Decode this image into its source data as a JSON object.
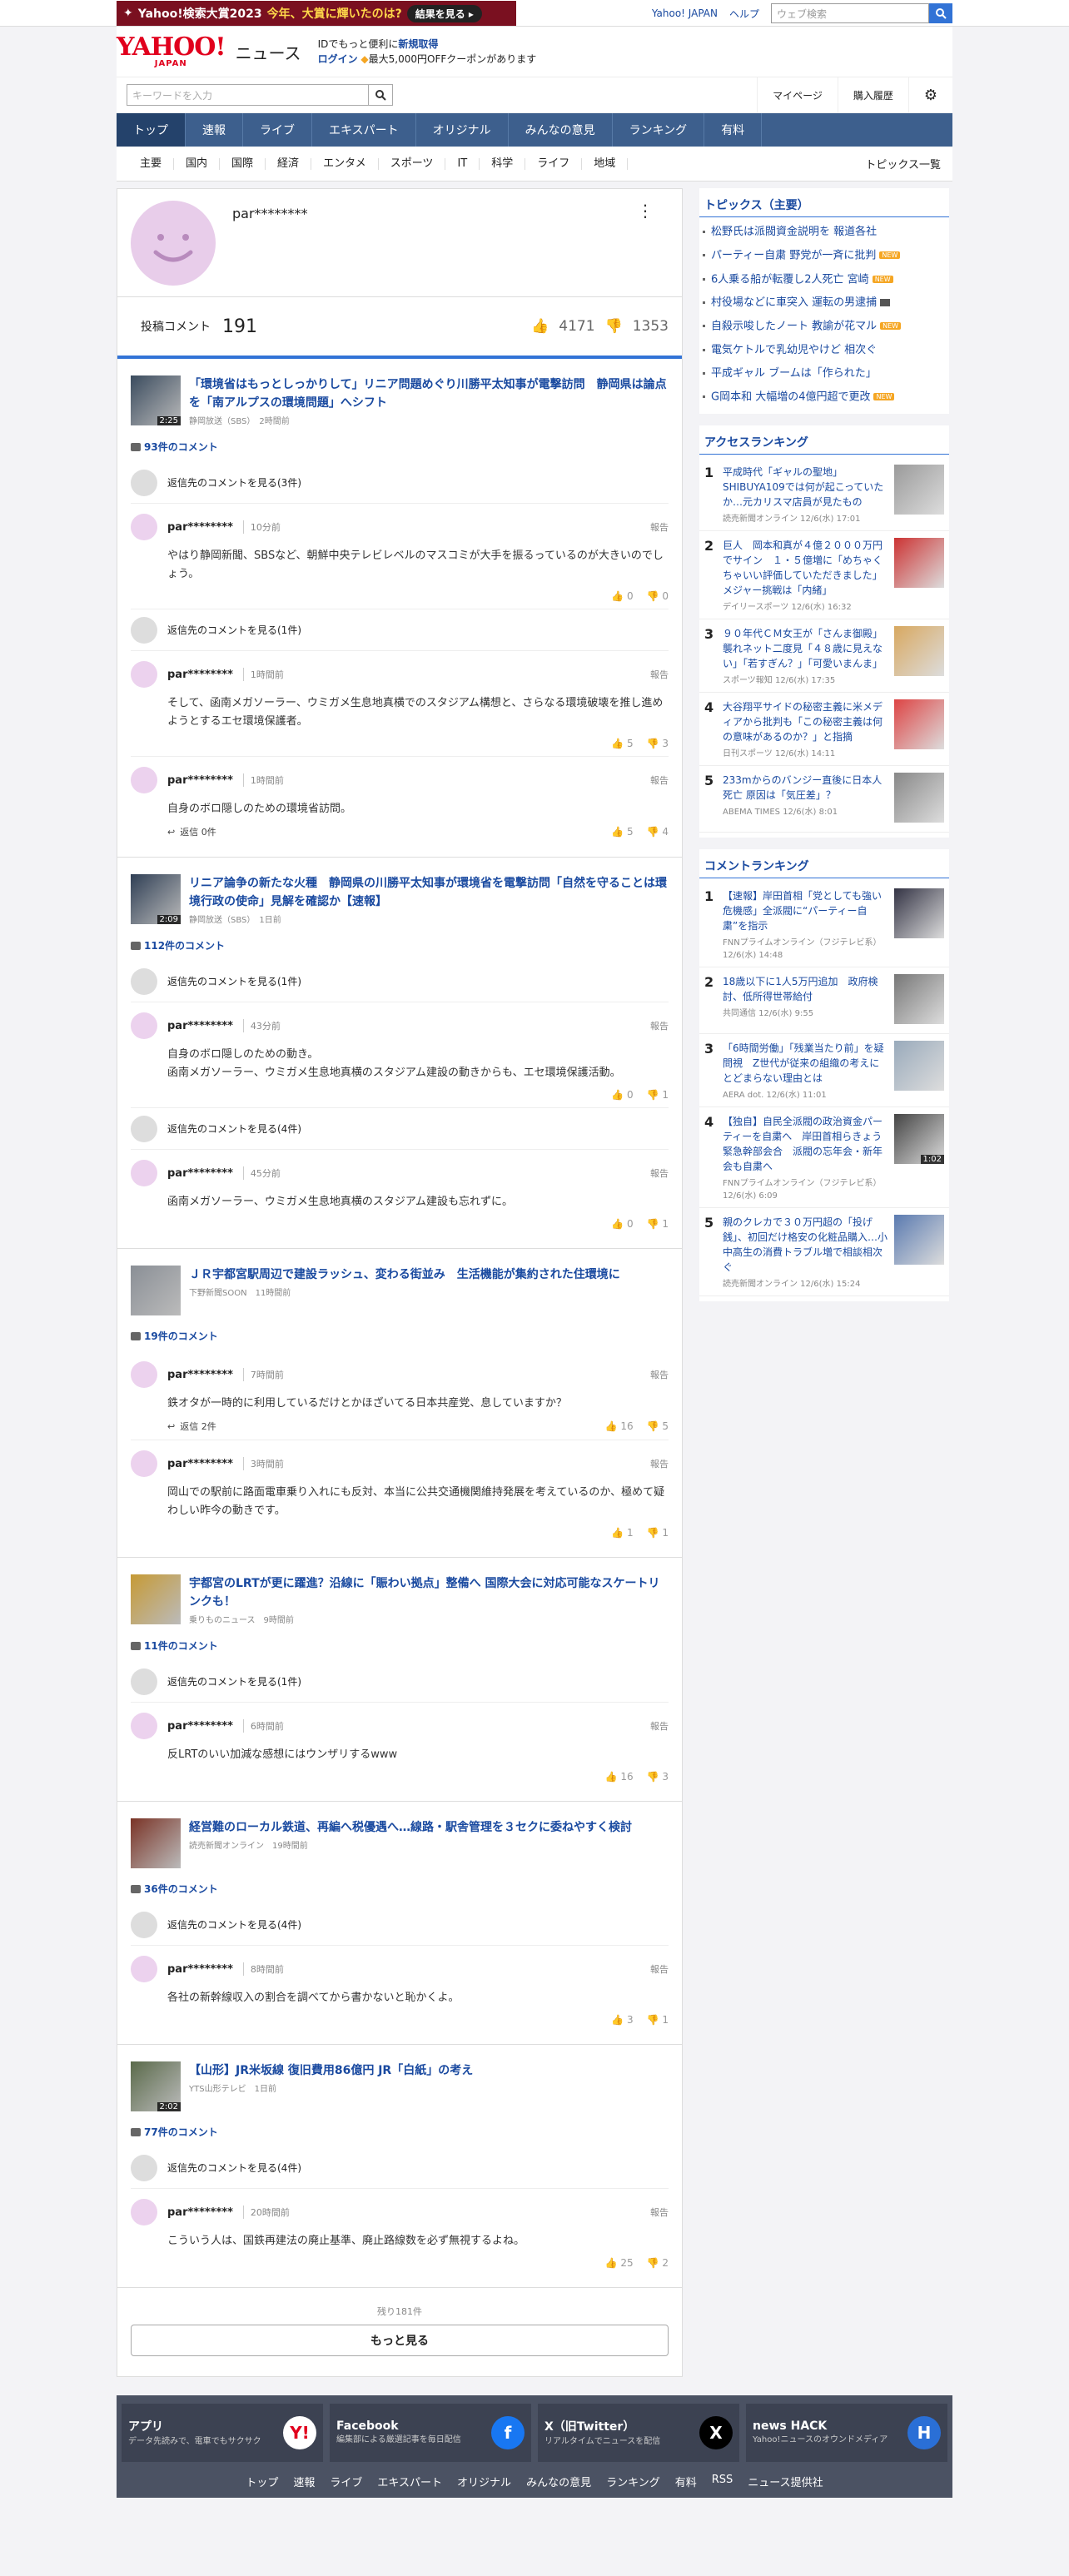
{
  "promo": {
    "text1": "Yahoo!検索大賞2023",
    "text2": "今年、大賞に輝いたのは?",
    "button": "結果を見る ▸"
  },
  "top_links": {
    "yahoo_japan": "Yahoo! JAPAN",
    "help": "ヘルプ",
    "search_placeholder": "ウェブ検索"
  },
  "header": {
    "logo": "YAHOO!",
    "logo_sub": "JAPAN",
    "news": "ニュース",
    "id_line1_pre": "IDでもっと便利に",
    "id_line1_link": "新規取得",
    "id_line2_link": "ログイン",
    "id_line2_text": "最大5,000円OFFクーポンがあります",
    "keyword_placeholder": "キーワードを入力",
    "mypage": "マイページ",
    "history": "購入履歴"
  },
  "main_nav": [
    "トップ",
    "速報",
    "ライブ",
    "エキスパート",
    "オリジナル",
    "みんなの意見",
    "ランキング",
    "有料"
  ],
  "sub_nav": [
    "主要",
    "国内",
    "国際",
    "経済",
    "エンタメ",
    "スポーツ",
    "IT",
    "科学",
    "ライフ",
    "地域"
  ],
  "sub_nav_topics": "トピックス一覧",
  "profile": {
    "name": "par********",
    "post_label": "投稿コメント",
    "post_count": "191",
    "likes": "4171",
    "dislikes": "1353"
  },
  "articles": [
    {
      "title": "「環境省はもっとしっかりして」リニア問題めぐり川勝平太知事が電撃訪問　静岡県は論点を「南アルプスの環境問題」へシフト",
      "source": "静岡放送（SBS）",
      "time": "2時間前",
      "duration": "2:25",
      "comment_count": "93件のコメント",
      "items": [
        {
          "type": "prev",
          "text": "返信先のコメントを見る(3件)"
        },
        {
          "type": "comment",
          "name": "par********",
          "time": "10分前",
          "report": "報告",
          "text": "やはり静岡新聞、SBSなど、朝鮮中央テレビレベルのマスコミが大手を振るっているのが大きいのでしょう。",
          "reply": "",
          "up": "0",
          "down": "0"
        },
        {
          "type": "prev",
          "text": "返信先のコメントを見る(1件)"
        },
        {
          "type": "comment",
          "name": "par********",
          "time": "1時間前",
          "report": "報告",
          "text": "そして、函南メガソーラー、ウミガメ生息地真横でのスタジアム構想と、さらなる環境破壊を推し進めようとするエセ環境保護者。",
          "reply": "",
          "up": "5",
          "down": "3"
        },
        {
          "type": "comment",
          "name": "par********",
          "time": "1時間前",
          "report": "報告",
          "text": "自身のボロ隠しのための環境省訪問。",
          "reply": "返信 0件",
          "up": "5",
          "down": "4"
        }
      ]
    },
    {
      "title": "リニア論争の新たな火種　静岡県の川勝平太知事が環境省を電撃訪問「自然を守ることは環境行政の使命」見解を確認か【速報】",
      "source": "静岡放送（SBS）",
      "time": "1日前",
      "duration": "2:09",
      "comment_count": "112件のコメント",
      "items": [
        {
          "type": "prev",
          "text": "返信先のコメントを見る(1件)"
        },
        {
          "type": "comment",
          "name": "par********",
          "time": "43分前",
          "report": "報告",
          "text": "自身のボロ隠しのための動き。\n函南メガソーラー、ウミガメ生息地真横のスタジアム建設の動きからも、エセ環境保護活動。",
          "reply": "",
          "up": "0",
          "down": "1"
        },
        {
          "type": "prev",
          "text": "返信先のコメントを見る(4件)"
        },
        {
          "type": "comment",
          "name": "par********",
          "time": "45分前",
          "report": "報告",
          "text": "函南メガソーラー、ウミガメ生息地真横のスタジアム建設も忘れずに。",
          "reply": "",
          "up": "0",
          "down": "1"
        }
      ]
    },
    {
      "title": "ＪＲ宇都宮駅周辺で建設ラッシュ、変わる街並み　生活機能が集約された住環境に",
      "source": "下野新聞SOON",
      "time": "11時間前",
      "duration": "",
      "comment_count": "19件のコメント",
      "items": [
        {
          "type": "comment",
          "name": "par********",
          "time": "7時間前",
          "report": "報告",
          "text": "鉄オタが一時的に利用しているだけとかほざいてる日本共産党、息していますか？",
          "reply": "返信 2件",
          "up": "16",
          "down": "5"
        },
        {
          "type": "comment",
          "name": "par********",
          "time": "3時間前",
          "report": "報告",
          "text": "岡山での駅前に路面電車乗り入れにも反対、本当に公共交通機関維持発展を考えているのか、極めて疑わしい昨今の動きです。",
          "reply": "",
          "up": "1",
          "down": "1"
        }
      ]
    },
    {
      "title": "宇都宮のLRTが更に躍進？沿線に「賑わい拠点」整備へ 国際大会に対応可能なスケートリンクも！",
      "source": "乗りものニュース",
      "time": "9時間前",
      "duration": "",
      "comment_count": "11件のコメント",
      "items": [
        {
          "type": "prev",
          "text": "返信先のコメントを見る(1件)"
        },
        {
          "type": "comment",
          "name": "par********",
          "time": "6時間前",
          "report": "報告",
          "text": "反LRTのいい加減な感想にはウンザリするwww",
          "reply": "",
          "up": "16",
          "down": "3"
        }
      ]
    },
    {
      "title": "経営難のローカル鉄道、再編へ税優遇へ…線路・駅舎管理を３セクに委ねやすく検討",
      "source": "読売新聞オンライン",
      "time": "19時間前",
      "duration": "",
      "comment_count": "36件のコメント",
      "items": [
        {
          "type": "prev",
          "text": "返信先のコメントを見る(4件)"
        },
        {
          "type": "comment",
          "name": "par********",
          "time": "8時間前",
          "report": "報告",
          "text": "各社の新幹線収入の割合を調べてから書かないと恥かくよ。",
          "reply": "",
          "up": "3",
          "down": "1"
        }
      ]
    },
    {
      "title": "【山形】JR米坂線 復旧費用86億円 JR「白紙」の考え",
      "source": "YTS山形テレビ",
      "time": "1日前",
      "duration": "2:02",
      "comment_count": "77件のコメント",
      "items": [
        {
          "type": "prev",
          "text": "返信先のコメントを見る(4件)"
        },
        {
          "type": "comment",
          "name": "par********",
          "time": "20時間前",
          "report": "報告",
          "text": "こういう人は、国鉄再建法の廃止基準、廃止路線数を必ず無視するよね。",
          "reply": "",
          "up": "25",
          "down": "2"
        }
      ]
    }
  ],
  "more": {
    "remaining": "残り181件",
    "button": "もっと見る"
  },
  "topics": {
    "heading": "トピックス（主要）",
    "items": [
      {
        "text": "松野氏は派閥資金説明を 報道各社",
        "badge": ""
      },
      {
        "text": "パーティー自粛 野党が一斉に批判",
        "badge": "NEW"
      },
      {
        "text": "6人乗る船が転覆し2人死亡 宮崎",
        "badge": "NEW"
      },
      {
        "text": "村役場などに車突入 運転の男逮捕",
        "badge": "video"
      },
      {
        "text": "自殺示唆したノート 教諭が花マル",
        "badge": "NEW"
      },
      {
        "text": "電気ケトルで乳幼児やけど 相次ぐ",
        "badge": ""
      },
      {
        "text": "平成ギャル ブームは「作られた」",
        "badge": ""
      },
      {
        "text": "G岡本和 大幅増の4億円超で更改",
        "badge": "NEW"
      }
    ]
  },
  "access_ranking": {
    "heading": "アクセスランキング",
    "items": [
      {
        "rank": "1",
        "title": "平成時代「ギャルの聖地」SHIBUYA109では何が起こっていたか…元カリスマ店員が見たもの",
        "source": "読売新聞オンライン 12/6(水) 17:01"
      },
      {
        "rank": "2",
        "title": "巨人　岡本和真が４億２０００万円でサイン　１・５億増に「めちゃくちゃいい評価していただきました」メジャー挑戦は「内緒」",
        "source": "デイリースポーツ 12/6(水) 16:32"
      },
      {
        "rank": "3",
        "title": "９０年代ＣＭ女王が「さんま御殿」襲れネット二度見「４８歳に見えない」「若すぎん？」「可愛いまんま」",
        "source": "スポーツ報知 12/6(水) 17:35"
      },
      {
        "rank": "4",
        "title": "大谷翔平サイドの秘密主義に米メディアから批判も「この秘密主義は何の意味があるのか？」と指摘",
        "source": "日刊スポーツ 12/6(水) 14:11"
      },
      {
        "rank": "5",
        "title": "233mからのバンジー直後に日本人死亡 原因は「気圧差」？",
        "source": "ABEMA TIMES 12/6(水) 8:01"
      }
    ]
  },
  "comment_ranking": {
    "heading": "コメントランキング",
    "items": [
      {
        "rank": "1",
        "title": "【速報】岸田首相「党としても強い危機感」全派閥に“パーティー自粛”を指示",
        "source": "FNNプライムオンライン（フジテレビ系） 12/6(水) 14:48",
        "duration": ""
      },
      {
        "rank": "2",
        "title": "18歳以下に1人5万円追加　政府検討、低所得世帯給付",
        "source": "共同通信 12/6(水) 9:55",
        "duration": ""
      },
      {
        "rank": "3",
        "title": "「6時間労働」「残業当たり前」を疑問視　Z世代が従来の組織の考えにとどまらない理由とは",
        "source": "AERA dot. 12/6(水) 11:01",
        "duration": ""
      },
      {
        "rank": "4",
        "title": "【独自】自民全派閥の政治資金パーティーを自粛へ　岸田首相らきょう緊急幹部会合　派閥の忘年会・新年会も自粛へ",
        "source": "FNNプライムオンライン（フジテレビ系） 12/6(水) 6:09",
        "duration": "1:02"
      },
      {
        "rank": "5",
        "title": "親のクレカで３０万円超の「投げ銭」、初回だけ格安の化粧品購入…小中高生の消費トラブル増で相談相次ぐ",
        "source": "読売新聞オンライン 12/6(水) 15:24",
        "duration": ""
      }
    ]
  },
  "footer": {
    "apps": [
      {
        "title": "アプリ",
        "desc": "データ先読みで、電車でもサクサク",
        "icon": "yahoo-news-app-icon",
        "mark": "Y!"
      },
      {
        "title": "Facebook",
        "desc": "編集部による厳選記事を毎日配信",
        "icon": "facebook-icon",
        "mark": "f"
      },
      {
        "title": "X（旧Twitter）",
        "desc": "リアルタイムでニュースを配信",
        "icon": "x-icon",
        "mark": "X"
      },
      {
        "title": "news HACK",
        "desc": "Yahoo!ニュースのオウンドメディア",
        "icon": "news-hack-icon",
        "mark": "H"
      }
    ],
    "links": [
      "トップ",
      "速報",
      "ライブ",
      "エキスパート",
      "オリジナル",
      "みんなの意見",
      "ランキング",
      "有料",
      "RSS",
      "ニュース提供社"
    ]
  },
  "colors": {
    "nav": "#3d5f8d",
    "link": "#1a4aa0",
    "accent": "#3273d6",
    "brand": "#e1001d"
  }
}
